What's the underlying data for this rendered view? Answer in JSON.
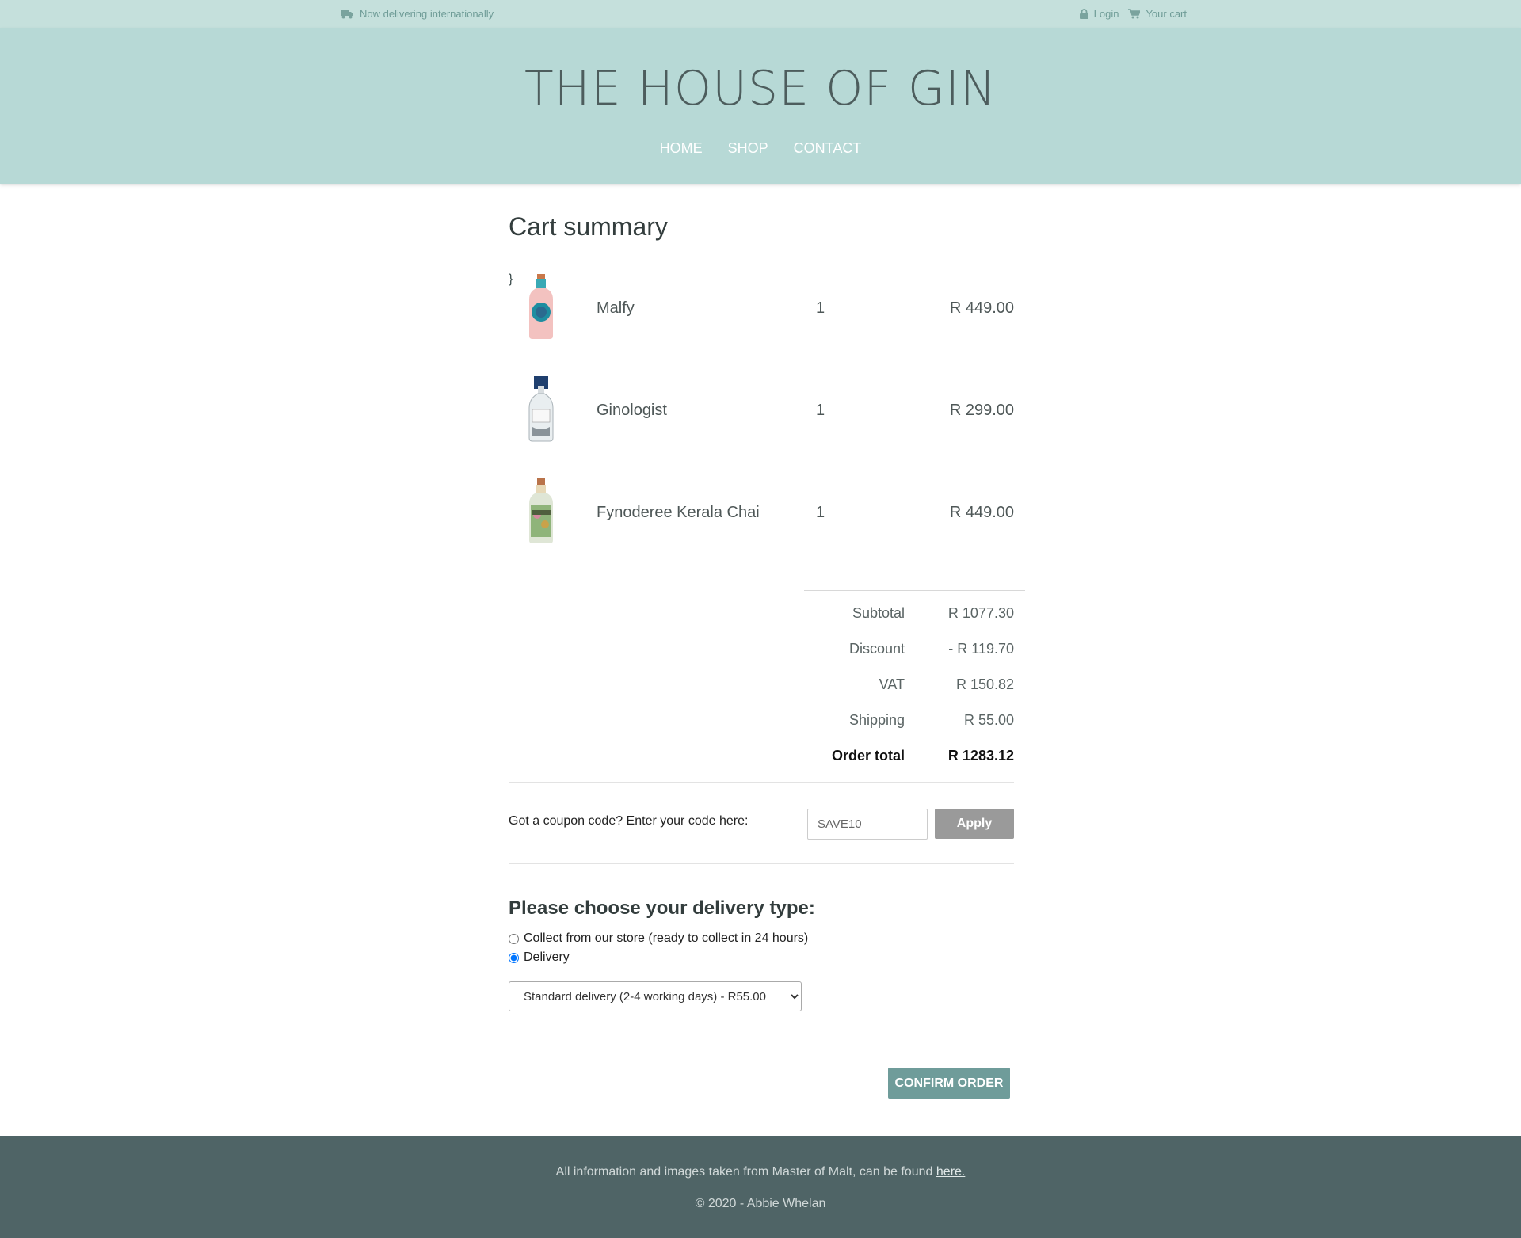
{
  "topbar": {
    "delivery_notice": "Now delivering internationally",
    "login_label": "Login",
    "cart_label": "Your cart"
  },
  "header": {
    "site_title": "THE HOUSE OF GIN",
    "nav": [
      "HOME",
      "SHOP",
      "CONTACT"
    ]
  },
  "cart": {
    "title": "Cart summary",
    "items": [
      {
        "name": "Malfy",
        "qty": "1",
        "price": "R 449.00",
        "image_icon": "pink-gin-bottle"
      },
      {
        "name": "Ginologist",
        "qty": "1",
        "price": "R 299.00",
        "image_icon": "clear-gin-bottle"
      },
      {
        "name": "Fynoderee Kerala Chai",
        "qty": "1",
        "price": "R 449.00",
        "image_icon": "illustrated-gin-bottle"
      }
    ],
    "totals": [
      {
        "label": "Subtotal",
        "value": "R 1077.30"
      },
      {
        "label": "Discount",
        "value": "- R 119.70"
      },
      {
        "label": "VAT",
        "value": "R 150.82"
      },
      {
        "label": "Shipping",
        "value": "R 55.00"
      },
      {
        "label": "Order total",
        "value": "R 1283.12"
      }
    ]
  },
  "coupon": {
    "label": "Got a coupon code? Enter your code here:",
    "value": "SAVE10",
    "apply_label": "Apply"
  },
  "delivery": {
    "title": "Please choose your delivery type:",
    "options": [
      {
        "label": "Collect from our store (ready to collect in 24 hours)",
        "checked": false
      },
      {
        "label": "Delivery",
        "checked": true
      }
    ],
    "selected_method": "Standard delivery (2-4 working days) - R55.00"
  },
  "confirm_label": "CONFIRM ORDER",
  "footer": {
    "info_text": "All information and images taken from Master of Malt, can be found",
    "link_text": "here.",
    "copyright": "© 2020 - Abbie Whelan"
  },
  "colors": {
    "topbar_bg": "#c5e0dc",
    "header_bg": "#b7d9d6",
    "footer_bg": "#4f6466",
    "confirm_btn": "#6f9c9a",
    "apply_btn": "#9a9a9a"
  }
}
